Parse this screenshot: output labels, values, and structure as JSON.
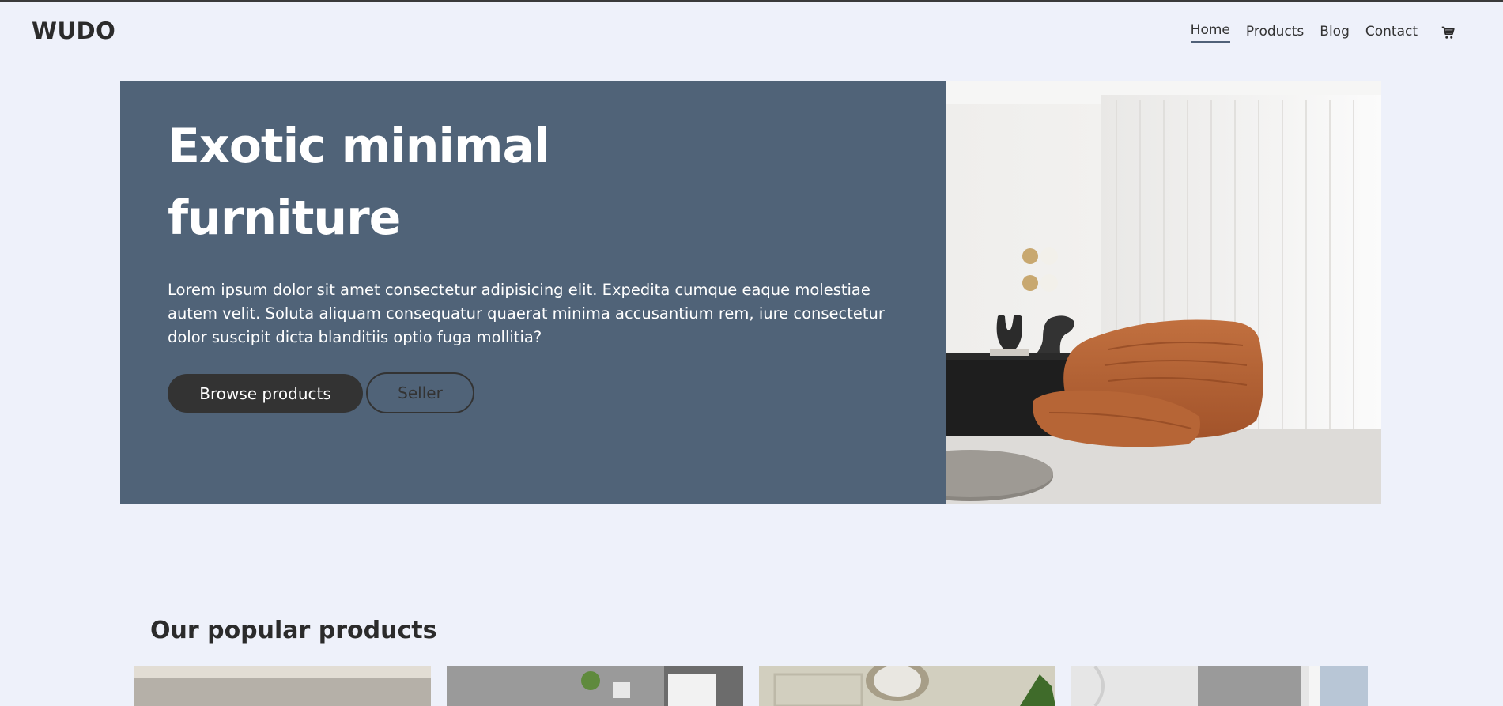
{
  "brand": {
    "logo": "WUDO"
  },
  "nav": {
    "items": [
      {
        "label": "Home",
        "active": true
      },
      {
        "label": "Products",
        "active": false
      },
      {
        "label": "Blog",
        "active": false
      },
      {
        "label": "Contact",
        "active": false
      }
    ],
    "cart_icon": "cart-icon"
  },
  "hero": {
    "title_line1": "Exotic minimal",
    "title_line2": "furniture",
    "description": "Lorem ipsum dolor sit amet consectetur adipisicing elit. Expedita cumque eaque molestiae autem velit. Soluta aliquam consequatur quaerat minima accusantium rem, iure consectetur dolor suscipit dicta blanditiis optio fuga mollitia?",
    "primary_button": "Browse products",
    "secondary_button": "Seller"
  },
  "popular": {
    "title": "Our popular products"
  },
  "colors": {
    "background": "#eef1fa",
    "hero_panel": "#506378",
    "dark": "#333333",
    "nav_active": "#506178"
  }
}
